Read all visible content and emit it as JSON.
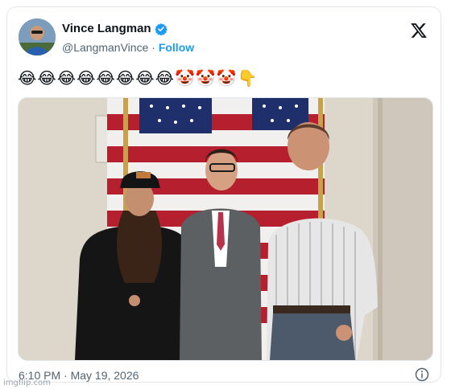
{
  "author": {
    "display_name": "Vince Langman",
    "handle": "@LangmanVince",
    "separator": "·",
    "follow_label": "Follow",
    "verified": true
  },
  "tweet": {
    "text": "😂😂😂😂😂😂😂😂🤡🤡🤡👇",
    "timestamp": "6:10 PM · May 19, 2026"
  },
  "icons": {
    "verified": "verified-badge-icon",
    "platform_logo": "x-logo-icon",
    "info": "info-icon"
  },
  "watermark": "imgflip.com",
  "colors": {
    "accent": "#1d9bf0",
    "text_primary": "#0f1419",
    "text_secondary": "#536471",
    "border": "#e1e6ea"
  }
}
